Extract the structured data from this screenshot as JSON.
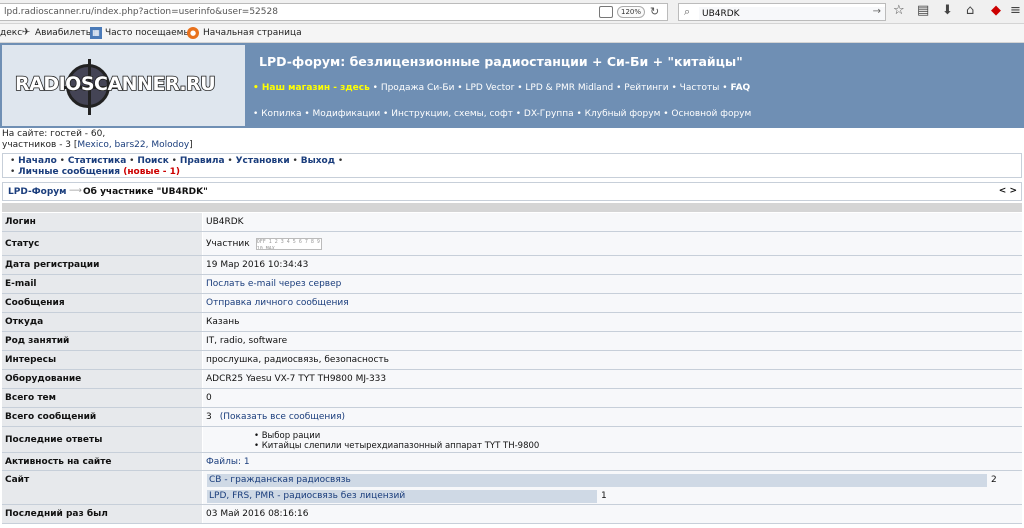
{
  "browser": {
    "url": "lpd.radioscanner.ru/index.php?action=userinfo&user=52528",
    "zoom": "120%",
    "search_value": "UB4RDK"
  },
  "bookmarks": [
    {
      "label": "декс",
      "icon": ""
    },
    {
      "label": "Авиабилеты",
      "icon": "plane-icon"
    },
    {
      "label": "Часто посещаемые",
      "icon": "bookmark-page-icon"
    },
    {
      "label": "Начальная страница",
      "icon": "firefox-icon"
    }
  ],
  "site": {
    "logo_text": "RADIOSCANNER.RU",
    "title": "LPD-форум: безлицензионные радиостанции + Си-Би + \"китайцы\"",
    "nav1": {
      "shop": "• Наш магазин - здесь",
      "rest": "• Продажа Си-Би • LPD Vector • LPD & PMR Midland • Рейтинги • Частоты •",
      "faq": "FAQ"
    },
    "nav2": "• Копилка • Модификации • Инструкции, схемы, софт • DX-Группа • Клубный форум • Основной форум"
  },
  "online": {
    "line1": "На сайте: гостей - 60,",
    "line2_prefix": "участников - 3 [",
    "users": "Mexico, bars22, Molodoy",
    "line2_suffix": "]"
  },
  "menu": {
    "items": [
      "Начало",
      "Статистика",
      "Поиск",
      "Правила",
      "Установки",
      "Выход"
    ],
    "messages_label": "Личные сообщения",
    "messages_new": "(новые - 1)"
  },
  "breadcrumb": {
    "forum": "LPD-Форум",
    "page": "Об участнике \"UB4RDK\"",
    "pager": "< >"
  },
  "profile": [
    {
      "label": "Логин",
      "value": "UB4RDK"
    },
    {
      "label": "Статус",
      "value": "Участник",
      "meter": "OFF 1 2 3 4 5 6 7 8 9 10 MAX"
    },
    {
      "label": "Дата регистрации",
      "value": "19 Мар 2016 10:34:43"
    },
    {
      "label": "E-mail",
      "value": "Послать e-mail через сервер"
    },
    {
      "label": "Сообщения",
      "value": "Отправка личного сообщения"
    },
    {
      "label": "Откуда",
      "value": "Казань"
    },
    {
      "label": "Род занятий",
      "value": "IT, radio, software"
    },
    {
      "label": "Интересы",
      "value": "прослушка, радиосвязь, безопасность"
    },
    {
      "label": "Оборудование",
      "value": "ADCR25 Yaesu VX-7 TYT TH9800 MJ-333"
    },
    {
      "label": "Всего тем",
      "value": "0"
    },
    {
      "label": "Всего сообщений",
      "value": "3",
      "link": "(Показать все сообщения)"
    },
    {
      "label": "Последние ответы",
      "replies": [
        "Выбор рации",
        "Китайцы слепили четырехдиапазонный аппарат TYT TH-9800"
      ]
    },
    {
      "label": "Активность на сайте",
      "value": "Файлы: 1"
    },
    {
      "label": "Сайт",
      "sections": [
        {
          "name": "СВ - гражданская радиосвязь",
          "count": "2",
          "share": 1.0
        },
        {
          "name": "LPD, FRS, PMR - радиосвязь без лицензий",
          "count": "1",
          "share": 0.5
        }
      ]
    },
    {
      "label": "Последний раз был",
      "value": "03 Май 2016 08:16:16"
    }
  ]
}
